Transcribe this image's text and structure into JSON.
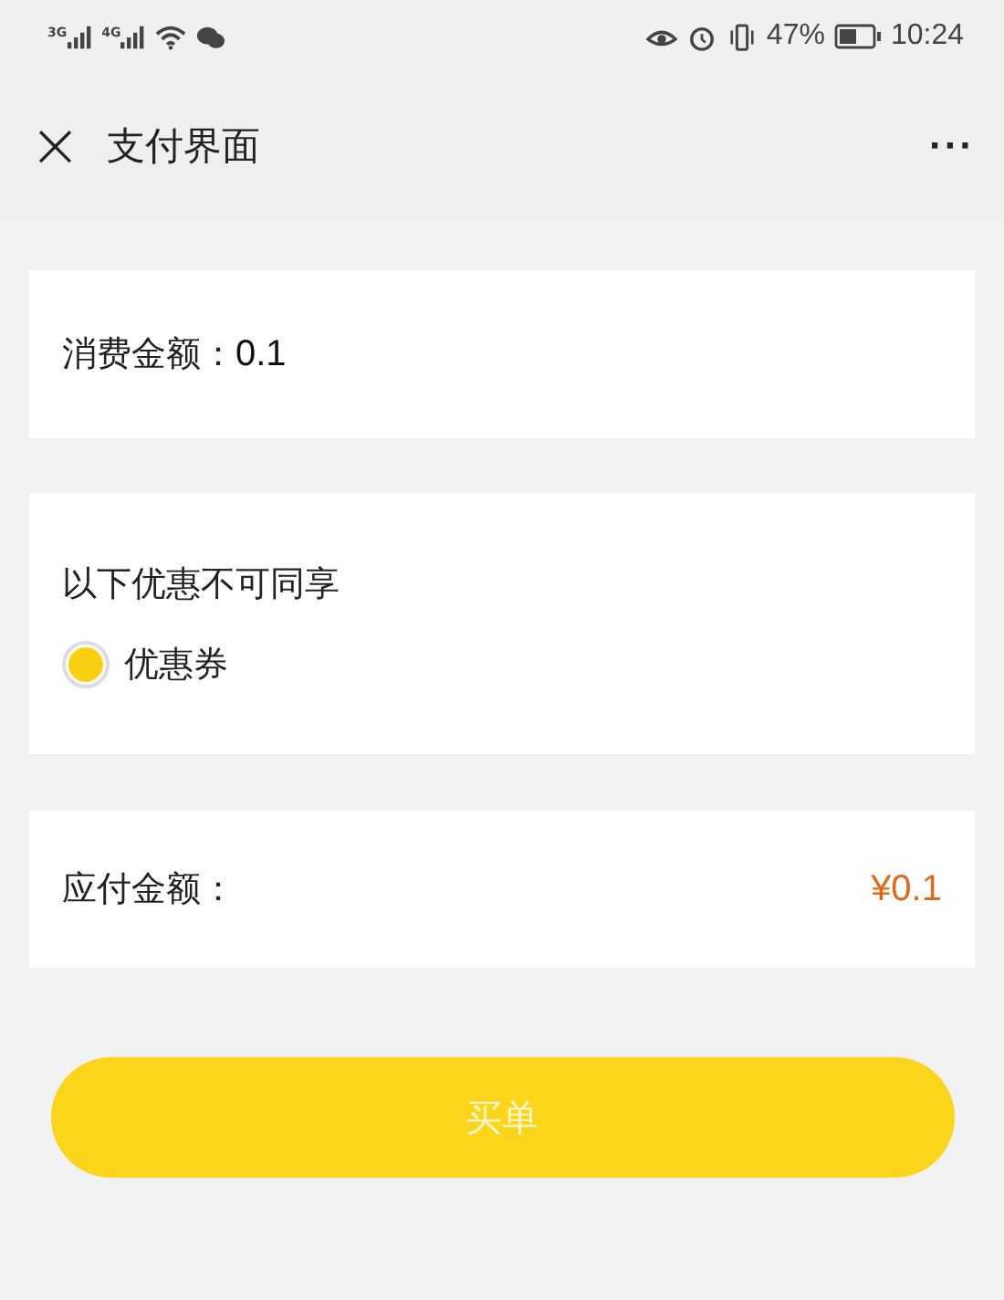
{
  "status_bar": {
    "networks": [
      "3G",
      "4G"
    ],
    "battery": "47%",
    "time": "10:24"
  },
  "header": {
    "close": "×",
    "title": "支付界面",
    "more": "···"
  },
  "amount_card": {
    "label": "消费金额：",
    "value": "0.1"
  },
  "discount_card": {
    "title": "以下优惠不可同享",
    "options": [
      {
        "label": "优惠券",
        "selected": true
      }
    ]
  },
  "payable_card": {
    "label": "应付金额：",
    "value": "¥0.1"
  },
  "buy_button": {
    "label": "买单"
  }
}
